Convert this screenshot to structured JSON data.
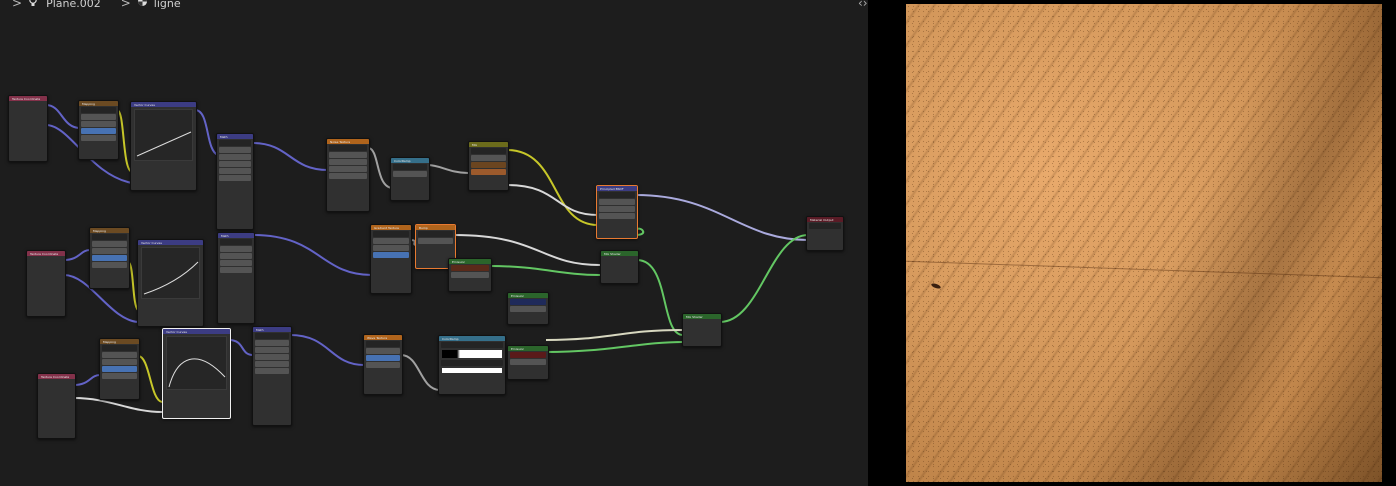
{
  "breadcrumb": {
    "object_name": "Plane.002",
    "material_name": "ligne",
    "object_icon": "lightbulb-icon",
    "material_icon": "material-sphere-icon",
    "separator": ">"
  },
  "colors": {
    "editor_bg": "#1d1d1d",
    "node_body": "#303030",
    "header_input": "#83314a",
    "header_vector": "#6b4a22",
    "header_converter": "#3c3c83",
    "header_texture": "#b0641c",
    "header_color": "#6b6b1b",
    "header_shader": "#2b652b",
    "header_output": "#5a1b26",
    "header_mixrgb": "#356f8a",
    "wire_vector": "#6363c7",
    "wire_shader": "#63c763",
    "wire_color": "#c7c729",
    "wire_float": "#a1a1a1",
    "selected_outline": "#e87a31"
  },
  "nodes": [
    {
      "id": "texcoord-1",
      "title": "Texture Coordinate",
      "type": "input"
    },
    {
      "id": "mapping-1",
      "title": "Mapping",
      "type": "vector"
    },
    {
      "id": "curves-1",
      "title": "Vector Curves",
      "type": "vector-curves"
    },
    {
      "id": "math-1",
      "title": "Math",
      "type": "converter"
    },
    {
      "id": "noise-1",
      "title": "Noise Texture",
      "type": "texture"
    },
    {
      "id": "colorramp-1",
      "title": "ColorRamp",
      "type": "mixrgb"
    },
    {
      "id": "mix-1",
      "title": "Mix",
      "type": "color"
    },
    {
      "id": "principled-1",
      "title": "Principled BSDF",
      "type": "converter"
    },
    {
      "id": "output-1",
      "title": "Material Output",
      "type": "output"
    },
    {
      "id": "texcoord-2",
      "title": "Texture Coordinate",
      "type": "input"
    },
    {
      "id": "mapping-2",
      "title": "Mapping",
      "type": "vector"
    },
    {
      "id": "curves-2",
      "title": "Vector Curves",
      "type": "vector-curves"
    },
    {
      "id": "math-2",
      "title": "Math",
      "type": "converter"
    },
    {
      "id": "gradient-1",
      "title": "Gradient Texture",
      "type": "texture"
    },
    {
      "id": "bump-1",
      "title": "Bump",
      "type": "texture"
    },
    {
      "id": "emission-1",
      "title": "Emission",
      "type": "shader"
    },
    {
      "id": "mixshader-1",
      "title": "Mix Shader",
      "type": "shader"
    },
    {
      "id": "emission-2",
      "title": "Emission",
      "type": "shader"
    },
    {
      "id": "mixshader-2",
      "title": "Mix Shader",
      "type": "shader"
    },
    {
      "id": "texcoord-3",
      "title": "Texture Coordinate",
      "type": "input"
    },
    {
      "id": "mapping-3",
      "title": "Mapping",
      "type": "vector"
    },
    {
      "id": "curves-3",
      "title": "Vector Curves",
      "type": "vector-curves"
    },
    {
      "id": "math-3",
      "title": "Math",
      "type": "converter"
    },
    {
      "id": "wave-1",
      "title": "Wave Texture",
      "type": "texture"
    },
    {
      "id": "colorramp-2",
      "title": "ColorRamp",
      "type": "mixrgb"
    },
    {
      "id": "emission-3",
      "title": "Emission",
      "type": "shader"
    }
  ]
}
